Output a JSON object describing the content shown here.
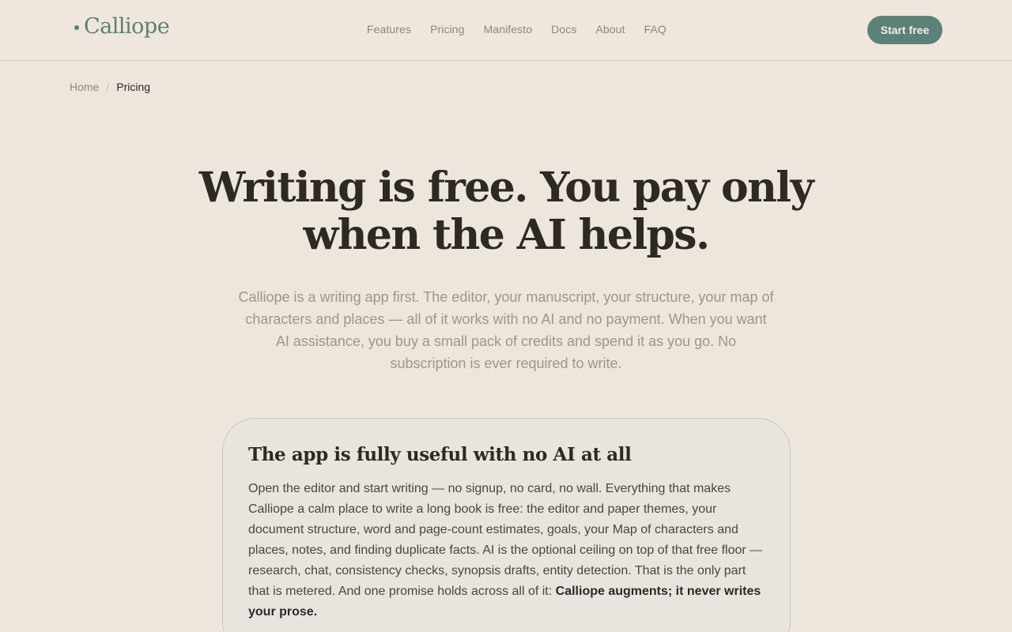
{
  "header": {
    "logo": "Calliope",
    "nav": [
      "Features",
      "Pricing",
      "Manifesto",
      "Docs",
      "About",
      "FAQ"
    ],
    "cta": "Start free"
  },
  "breadcrumb": {
    "home": "Home",
    "separator": "/",
    "current": "Pricing"
  },
  "hero": {
    "title_line1": "Writing is free. You pay only",
    "title_line2": "when the AI helps.",
    "subtitle": "Calliope is a writing app first. The editor, your manuscript, your structure, your map of characters and places — all of it works with no AI and no payment. When you want AI assistance, you buy a small pack of credits and spend it as you go. No subscription is ever required to write."
  },
  "card": {
    "title": "The app is fully useful with no AI at all",
    "body": "Open the editor and start writing — no signup, no card, no wall. Everything that makes Calliope a calm place to write a long book is free: the editor and paper themes, your document structure, word and page-count estimates, goals, your Map of characters and places, notes, and finding duplicate facts. AI is the optional ceiling on top of that free floor — research, chat, consistency checks, synopsis drafts, entity detection. That is the only part that is metered. And one promise holds across all of it:",
    "emphasis": "Calliope augments; it never writes your prose."
  },
  "colors": {
    "background": "#ece6dc",
    "accent": "#5c8179",
    "text": "#2c2a22",
    "muted": "#9e968a"
  }
}
